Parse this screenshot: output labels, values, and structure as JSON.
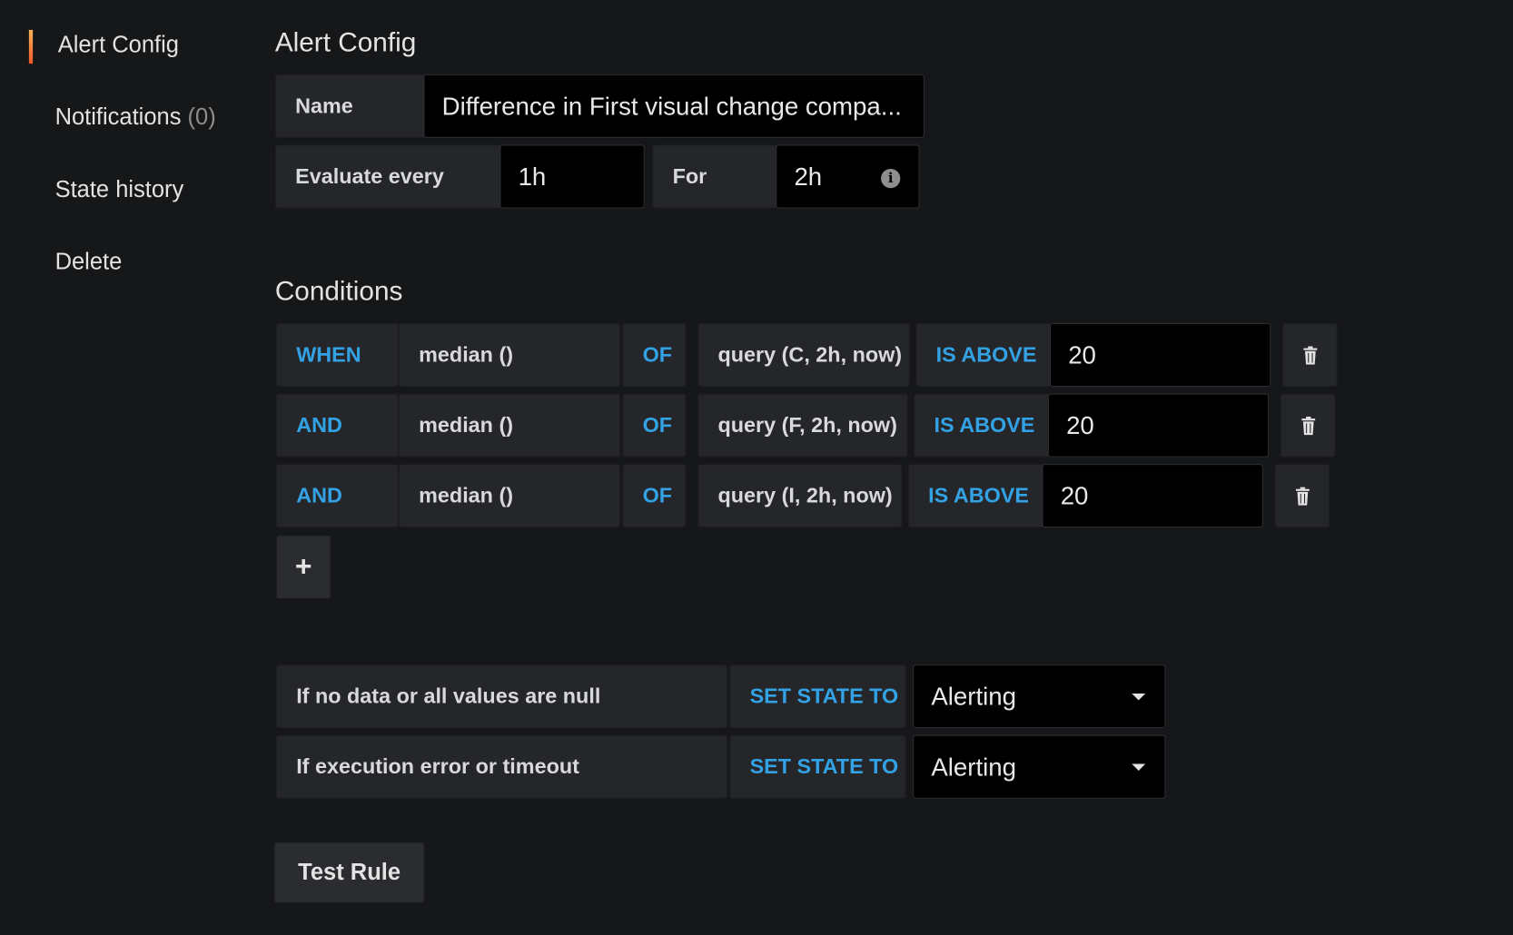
{
  "sidebar": {
    "items": [
      {
        "label": "Alert Config",
        "active": true
      },
      {
        "label": "Notifications",
        "count": "(0)"
      },
      {
        "label": "State history"
      },
      {
        "label": "Delete"
      }
    ],
    "accent_color": "#f05a28"
  },
  "alert_config": {
    "title": "Alert Config",
    "name_label": "Name",
    "name_value": "Difference in First visual change compa...",
    "evaluate_label": "Evaluate every",
    "evaluate_value": "1h",
    "for_label": "For",
    "for_value": "2h",
    "for_icon": "info-icon"
  },
  "conditions": {
    "title": "Conditions",
    "rows": [
      {
        "operator": "WHEN",
        "reducer": "median ()",
        "of": "OF",
        "query": "query (C, 2h, now)",
        "evaluator": "IS ABOVE",
        "value": "20"
      },
      {
        "operator": "AND",
        "reducer": "median ()",
        "of": "OF",
        "query": "query (F, 2h, now)",
        "evaluator": "IS ABOVE",
        "value": "20"
      },
      {
        "operator": "AND",
        "reducer": "median ()",
        "of": "OF",
        "query": "query (I, 2h, now)",
        "evaluator": "IS ABOVE",
        "value": "20"
      }
    ],
    "add_label": "+",
    "keyword_color": "#33a2e5"
  },
  "handling": {
    "rows": [
      {
        "label": "If no data or all values are null",
        "set_state": "SET STATE TO",
        "value": "Alerting"
      },
      {
        "label": "If execution error or timeout",
        "set_state": "SET STATE TO",
        "value": "Alerting"
      }
    ]
  },
  "test_rule_label": "Test Rule"
}
